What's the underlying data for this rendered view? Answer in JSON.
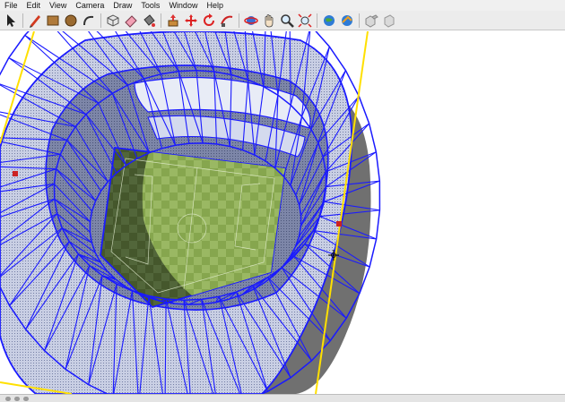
{
  "menu": {
    "items": [
      "File",
      "Edit",
      "View",
      "Camera",
      "Draw",
      "Tools",
      "Window",
      "Help"
    ]
  },
  "toolbar": {
    "tools": [
      {
        "name": "select-tool",
        "icon": "arrow-cursor-icon"
      },
      {
        "name": "line-tool",
        "icon": "pencil-icon"
      },
      {
        "name": "rectangle-tool",
        "icon": "rectangle-icon"
      },
      {
        "name": "circle-tool",
        "icon": "circle-icon"
      },
      {
        "name": "arc-tool",
        "icon": "arc-icon"
      },
      {
        "name": "make-component-tool",
        "icon": "component-box-icon"
      },
      {
        "name": "eraser-tool",
        "icon": "eraser-icon"
      },
      {
        "name": "paint-bucket-tool",
        "icon": "paint-bucket-icon"
      },
      {
        "name": "push-pull-tool",
        "icon": "push-pull-icon"
      },
      {
        "name": "move-tool",
        "icon": "move-arrows-icon"
      },
      {
        "name": "rotate-tool",
        "icon": "rotate-icon"
      },
      {
        "name": "follow-me-tool",
        "icon": "follow-me-icon"
      },
      {
        "name": "orbit-tool",
        "icon": "orbit-icon"
      },
      {
        "name": "pan-tool",
        "icon": "hand-icon"
      },
      {
        "name": "zoom-tool",
        "icon": "magnifier-icon"
      },
      {
        "name": "zoom-extents-tool",
        "icon": "zoom-extents-icon"
      },
      {
        "name": "get-models-tool",
        "icon": "warehouse-globe-icon"
      },
      {
        "name": "share-model-tool",
        "icon": "share-globe-icon"
      },
      {
        "name": "components-tool",
        "icon": "components-icon"
      },
      {
        "name": "extension-tool",
        "icon": "extension-icon"
      }
    ]
  },
  "colors": {
    "edge_blue": "#1a1aff",
    "axis_yellow": "#ffe000",
    "field_green": "#6a8f3d",
    "shadow_gray": "#6e6e6e",
    "inner_face": "#c4cce2",
    "endpoint_red": "#cc2222"
  }
}
